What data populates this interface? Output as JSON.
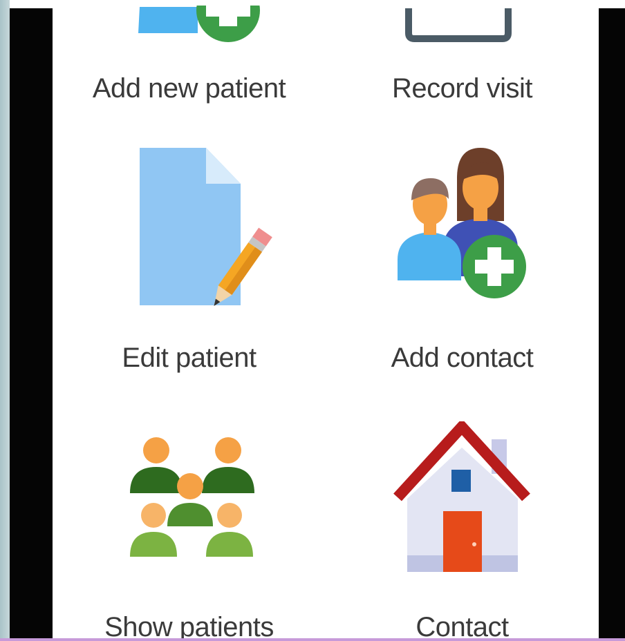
{
  "menu": {
    "items": [
      {
        "label": "Add new patient",
        "icon": "add-patient-icon"
      },
      {
        "label": "Record visit",
        "icon": "record-visit-icon"
      },
      {
        "label": "Edit patient",
        "icon": "edit-patient-icon"
      },
      {
        "label": "Add contact",
        "icon": "add-contact-icon"
      },
      {
        "label": "Show patients",
        "icon": "show-patients-icon"
      },
      {
        "label": "Contact",
        "icon": "house-icon"
      }
    ]
  },
  "colors": {
    "plus_green": "#3d9e48",
    "doc_blue": "#90c6f3",
    "roof_red": "#b71c1c",
    "door_orange": "#e64a19",
    "people_dark_green": "#2e6b1f",
    "people_light_green": "#7cb342",
    "skin_orange": "#f5a145"
  }
}
